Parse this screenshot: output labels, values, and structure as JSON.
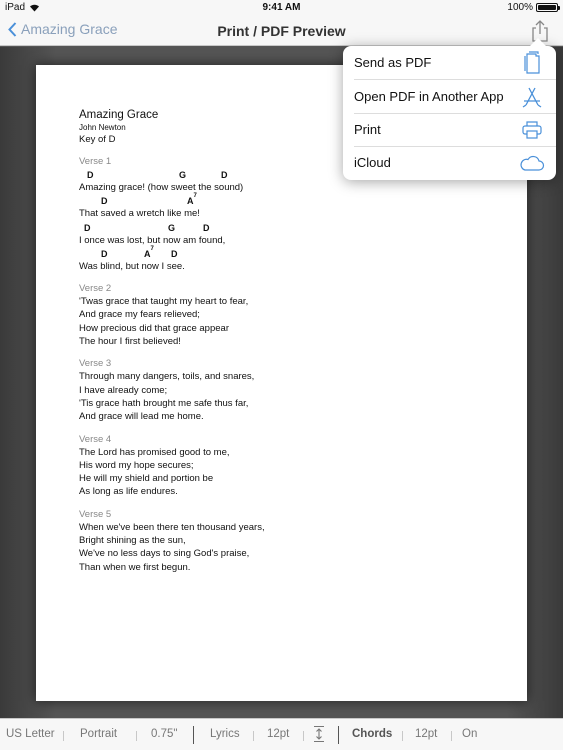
{
  "status_bar": {
    "carrier": "iPad",
    "time": "9:41 AM",
    "battery_percent": "100%",
    "battery_level": 1.0
  },
  "nav": {
    "back_label": "Amazing Grace",
    "title": "Print / PDF Preview"
  },
  "song": {
    "title": "Amazing Grace",
    "author": "John Newton",
    "key": "Key of D",
    "verses": [
      {
        "label": "Verse 1",
        "lines": [
          {
            "text": "Amazing grace! (how sweet the sound)",
            "chords": [
              {
                "name": "D",
                "sup": ""
              },
              {
                "name": "G",
                "sup": ""
              },
              {
                "name": "D",
                "sup": ""
              }
            ]
          },
          {
            "text": "That saved a wretch like me!",
            "chords": [
              {
                "name": "D",
                "sup": ""
              },
              {
                "name": "A",
                "sup": "7"
              }
            ]
          },
          {
            "text": "I once was lost, but now am found,",
            "chords": [
              {
                "name": "D",
                "sup": ""
              },
              {
                "name": "G",
                "sup": ""
              },
              {
                "name": "D",
                "sup": ""
              }
            ]
          },
          {
            "text": "Was blind, but now I see.",
            "chords": [
              {
                "name": "D",
                "sup": ""
              },
              {
                "name": "A",
                "sup": "7"
              },
              {
                "name": "D",
                "sup": ""
              }
            ]
          }
        ]
      },
      {
        "label": "Verse 2",
        "lines": [
          {
            "text": "'Twas grace that taught my heart to fear,"
          },
          {
            "text": "And grace my fears relieved;"
          },
          {
            "text": "How precious did that grace appear"
          },
          {
            "text": "The hour I first believed!"
          }
        ]
      },
      {
        "label": "Verse 3",
        "lines": [
          {
            "text": "Through many dangers, toils, and snares,"
          },
          {
            "text": "I have already come;"
          },
          {
            "text": "'Tis grace hath brought me safe thus far,"
          },
          {
            "text": "And grace will lead me home."
          }
        ]
      },
      {
        "label": "Verse 4",
        "lines": [
          {
            "text": "The Lord has promised good to me,"
          },
          {
            "text": "His word my hope secures;"
          },
          {
            "text": "He will my shield and portion be"
          },
          {
            "text": "As long as life endures."
          }
        ]
      },
      {
        "label": "Verse 5",
        "lines": [
          {
            "text": "When we've been there ten thousand years,"
          },
          {
            "text": "Bright shining as the sun,"
          },
          {
            "text": "We've no less days to sing God's praise,"
          },
          {
            "text": "Than when we first begun."
          }
        ]
      }
    ]
  },
  "share_menu": {
    "items": [
      {
        "label": "Send as PDF",
        "icon": "document-share-icon"
      },
      {
        "label": "Open PDF in Another App",
        "icon": "app-store-icon"
      },
      {
        "label": "Print",
        "icon": "printer-icon"
      },
      {
        "label": "iCloud",
        "icon": "cloud-icon"
      }
    ]
  },
  "toolbar": {
    "paper_size": "US Letter",
    "orientation": "Portrait",
    "margin": "0.75\"",
    "lyrics_label": "Lyrics",
    "lyrics_size": "12pt",
    "chords_label": "Chords",
    "chords_size": "12pt",
    "chords_state": "On"
  },
  "colors": {
    "accent": "#8aa0bb",
    "icon_blue": "#4a90d9"
  }
}
